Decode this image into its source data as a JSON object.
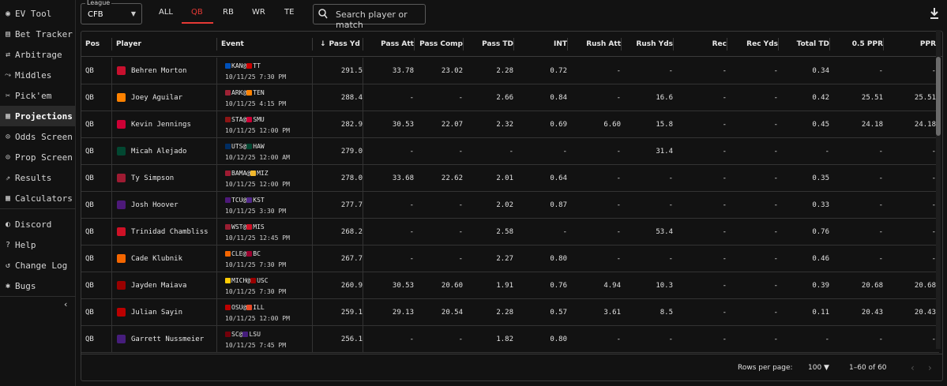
{
  "sidebar": {
    "items": [
      {
        "label": "EV Tool",
        "icon": "location-pin-icon",
        "glyph": "◉"
      },
      {
        "label": "Bet Tracker",
        "icon": "tracker-icon",
        "glyph": "▤"
      },
      {
        "label": "Arbitrage",
        "icon": "arbitrage-icon",
        "glyph": "⇄"
      },
      {
        "label": "Middles",
        "icon": "middles-icon",
        "glyph": "⤳"
      },
      {
        "label": "Pick'em",
        "icon": "pickem-icon",
        "glyph": "✂"
      },
      {
        "label": "Projections",
        "icon": "projections-icon",
        "glyph": "▦",
        "active": true
      },
      {
        "label": "Odds Screen",
        "icon": "odds-screen-icon",
        "glyph": "⊙"
      },
      {
        "label": "Prop Screen",
        "icon": "prop-screen-icon",
        "glyph": "⊙"
      },
      {
        "label": "Results",
        "icon": "results-icon",
        "glyph": "⇗"
      },
      {
        "label": "Calculators",
        "icon": "calculator-icon",
        "glyph": "▦"
      },
      {
        "label": "Discord",
        "icon": "discord-icon",
        "glyph": "◐"
      },
      {
        "label": "Help",
        "icon": "help-icon",
        "glyph": "?"
      },
      {
        "label": "Change Log",
        "icon": "history-icon",
        "glyph": "↺"
      },
      {
        "label": "Bugs",
        "icon": "bug-icon",
        "glyph": "✱"
      }
    ],
    "collapse_glyph": "‹"
  },
  "topbar": {
    "league_label": "League",
    "league_value": "CFB",
    "league_arrow": "▼",
    "tabs": [
      "ALL",
      "QB",
      "RB",
      "WR",
      "TE"
    ],
    "active_tab": "QB",
    "search_placeholder": "Search player or match"
  },
  "table": {
    "columns": [
      "Pos",
      "Player",
      "Event",
      "Pass Yd",
      "Pass Att",
      "Pass Comp",
      "Pass TD",
      "INT",
      "Rush Att",
      "Rush Yds",
      "Rec",
      "Rec Yds",
      "Total TD",
      "0.5 PPR",
      "PPR"
    ],
    "sort_glyph": "↓",
    "rows": [
      {
        "pos": "QB",
        "player": "Behren Morton",
        "logo_color": "#c8102e",
        "away": "KAN",
        "away_color": "#0051ba",
        "home": "TT",
        "home_color": "#cc0000",
        "date": "10/11/25 7:30 PM",
        "stats": [
          "291.5",
          "33.78",
          "23.02",
          "2.28",
          "0.72",
          "-",
          "-",
          "-",
          "-",
          "0.34",
          "-",
          "-"
        ]
      },
      {
        "pos": "QB",
        "player": "Joey Aguilar",
        "logo_color": "#ff8200",
        "away": "ARK",
        "away_color": "#9d2235",
        "home": "TEN",
        "home_color": "#ff8200",
        "date": "10/11/25 4:15 PM",
        "stats": [
          "288.4",
          "-",
          "-",
          "2.66",
          "0.84",
          "-",
          "16.6",
          "-",
          "-",
          "0.42",
          "25.51",
          "25.51"
        ]
      },
      {
        "pos": "QB",
        "player": "Kevin Jennings",
        "logo_color": "#cc0035",
        "away": "STA",
        "away_color": "#8c1515",
        "home": "SMU",
        "home_color": "#cc0035",
        "date": "10/11/25 12:00 PM",
        "stats": [
          "282.9",
          "30.53",
          "22.07",
          "2.32",
          "0.69",
          "6.60",
          "15.8",
          "-",
          "-",
          "0.45",
          "24.18",
          "24.18"
        ]
      },
      {
        "pos": "QB",
        "player": "Micah Alejado",
        "logo_color": "#024731",
        "away": "UTS",
        "away_color": "#002d62",
        "home": "HAW",
        "home_color": "#024731",
        "date": "10/12/25 12:00 AM",
        "stats": [
          "279.0",
          "-",
          "-",
          "-",
          "-",
          "-",
          "31.4",
          "-",
          "-",
          "-",
          "-",
          "-"
        ]
      },
      {
        "pos": "QB",
        "player": "Ty Simpson",
        "logo_color": "#9e1b32",
        "away": "BAMA",
        "away_color": "#9e1b32",
        "home": "MIZ",
        "home_color": "#f1b82d",
        "date": "10/11/25 12:00 PM",
        "stats": [
          "278.0",
          "33.68",
          "22.62",
          "2.01",
          "0.64",
          "-",
          "-",
          "-",
          "-",
          "0.35",
          "-",
          "-"
        ]
      },
      {
        "pos": "QB",
        "player": "Josh Hoover",
        "logo_color": "#4d1979",
        "away": "TCU",
        "away_color": "#4d1979",
        "home": "KST",
        "home_color": "#512888",
        "date": "10/11/25 3:30 PM",
        "stats": [
          "277.7",
          "-",
          "-",
          "2.02",
          "0.87",
          "-",
          "-",
          "-",
          "-",
          "0.33",
          "-",
          "-"
        ]
      },
      {
        "pos": "QB",
        "player": "Trinidad Chambliss",
        "logo_color": "#ce1126",
        "away": "WST",
        "away_color": "#981e32",
        "home": "MIS",
        "home_color": "#ce1126",
        "date": "10/11/25 12:45 PM",
        "stats": [
          "268.2",
          "-",
          "-",
          "2.58",
          "-",
          "-",
          "53.4",
          "-",
          "-",
          "0.76",
          "-",
          "-"
        ]
      },
      {
        "pos": "QB",
        "player": "Cade Klubnik",
        "logo_color": "#f56600",
        "away": "CLE",
        "away_color": "#f56600",
        "home": "BC",
        "home_color": "#98002e",
        "date": "10/11/25 7:30 PM",
        "stats": [
          "267.7",
          "-",
          "-",
          "2.27",
          "0.80",
          "-",
          "-",
          "-",
          "-",
          "0.46",
          "-",
          "-"
        ]
      },
      {
        "pos": "QB",
        "player": "Jayden Maiava",
        "logo_color": "#990000",
        "away": "MICH",
        "away_color": "#ffcb05",
        "home": "USC",
        "home_color": "#990000",
        "date": "10/11/25 7:30 PM",
        "stats": [
          "260.9",
          "30.53",
          "20.60",
          "1.91",
          "0.76",
          "4.94",
          "10.3",
          "-",
          "-",
          "0.39",
          "20.68",
          "20.68"
        ]
      },
      {
        "pos": "QB",
        "player": "Julian Sayin",
        "logo_color": "#bb0000",
        "away": "OSU",
        "away_color": "#bb0000",
        "home": "ILL",
        "home_color": "#e84a27",
        "date": "10/11/25 12:00 PM",
        "stats": [
          "259.1",
          "29.13",
          "20.54",
          "2.28",
          "0.57",
          "3.61",
          "8.5",
          "-",
          "-",
          "0.11",
          "20.43",
          "20.43"
        ]
      },
      {
        "pos": "QB",
        "player": "Garrett Nussmeier",
        "logo_color": "#461d7c",
        "away": "SC",
        "away_color": "#73000a",
        "home": "LSU",
        "home_color": "#461d7c",
        "date": "10/11/25 7:45 PM",
        "stats": [
          "256.1",
          "-",
          "-",
          "1.82",
          "0.80",
          "-",
          "-",
          "-",
          "-",
          "-",
          "-",
          "-"
        ]
      }
    ]
  },
  "footer": {
    "rows_per_page_label": "Rows per page:",
    "rows_per_page_value": "100 ▼",
    "range": "1–60 of 60",
    "prev": "‹",
    "next": "›"
  }
}
